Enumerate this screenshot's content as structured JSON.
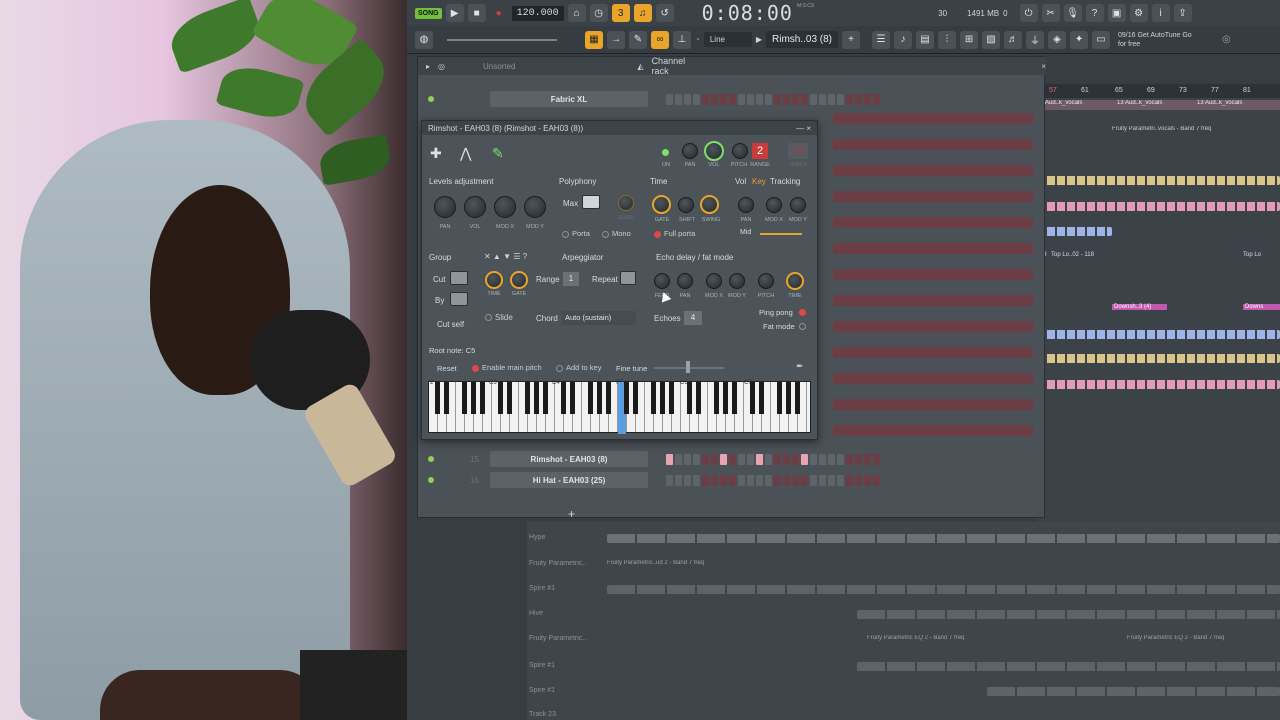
{
  "transport": {
    "song_label": "SONG",
    "tempo": "120.000",
    "time": "0:08:00",
    "time_unit": "M:S:CS",
    "cpu": "30",
    "memory": "1491 MB",
    "memory2": "0"
  },
  "toolbar": {
    "snap": "Line",
    "pattern": "Rimsh..03 (8)",
    "hint_line1": "09/16 Get AutoTune Go",
    "hint_line2": "for free"
  },
  "rack": {
    "filter": "Unsorted",
    "title": "Channel rack",
    "channels": [
      {
        "num": "",
        "name": "Fabric XL"
      },
      {
        "num": "15",
        "name": "Rimshot - EAH03 (8)"
      },
      {
        "num": "16",
        "name": "Hi Hat - EAH03 (25)"
      }
    ],
    "add": "+"
  },
  "plugin": {
    "title": "Rimshot - EAH03 (8) (Rimshot - EAH03 (8))",
    "num_red": "2",
    "num_dark": "15",
    "top_knob_labels": [
      "ON",
      "PAN",
      "VOL",
      "PITCH",
      "RANGE",
      "TRACK"
    ],
    "levels_title": "Levels adjustment",
    "levels_knobs": [
      "PAN",
      "VOL",
      "MOD X",
      "MOD Y"
    ],
    "poly_title": "Polyphony",
    "poly_max": "Max",
    "poly_slide": "SLIDE",
    "poly_porta": "Porta",
    "poly_mono": "Mono",
    "time_title": "Time",
    "time_knobs": [
      "GATE",
      "SHIFT",
      "SWING"
    ],
    "time_fullporta": "Full porta",
    "vol_label": "Vol",
    "key_label": "Key",
    "tracking_label": "Tracking",
    "tracking_knobs": [
      "PAN",
      "MOD X",
      "MOD Y"
    ],
    "tracking_mid": "Mid",
    "group_title": "Group",
    "cut_label": "Cut",
    "by_label": "By",
    "cutself_label": "Cut self",
    "arp_title": "Arpeggiator",
    "arp_range": "Range",
    "arp_range_val": "1",
    "arp_repeat": "Repeat",
    "arp_knobs": [
      "TIME",
      "GATE"
    ],
    "arp_slide": "Slide",
    "arp_chord": "Chord",
    "arp_chord_val": "Auto (sustain)",
    "echo_title": "Echo delay / fat mode",
    "echo_knobs": [
      "FEED",
      "PAN",
      "MOD X",
      "MOD Y",
      "PITCH",
      "TIME"
    ],
    "echoes_label": "Echoes",
    "echoes_val": "4",
    "pingpong": "Ping pong",
    "fatmode": "Fat mode",
    "root_note": "Root note: C5",
    "reset": "Reset",
    "enable_main_pitch": "Enable main pitch",
    "add_to_key": "Add to key",
    "fine_tune": "Fine tune",
    "octaves": [
      "2",
      "C3",
      "C4",
      "C5",
      "C6",
      "C7"
    ]
  },
  "playlist": {
    "bars": [
      "57",
      "61",
      "65",
      "69",
      "73",
      "77",
      "81"
    ],
    "clip_labels": [
      "13 Aud..k_vocals",
      "13 Aud..k_vocals",
      "13 Aud..k_vocals",
      "Fruity Parametri..vocals - Band 7 freq",
      "118",
      "Top Lo..02 - 118",
      "Top Lo",
      "Downsh..3 (4)",
      "Downs"
    ],
    "lower_tracks": [
      "Hype",
      "Fruity Parametric..",
      "Spire #1",
      "Hive",
      "Fruity Parametric..",
      "Spire #1",
      "Spire #1",
      "Track 23"
    ],
    "lower_clips": [
      "Fruity Parametric..ud 2 - Band 7 freq",
      "Fruity Parametric EQ 2 - Band 7 freq",
      "Fruity Parametric EQ 2 - Band 7 freq"
    ]
  },
  "colors": {
    "accent": "#e9a52a",
    "record": "#e03838",
    "song": "#6fc03a",
    "step_on": "#e7a4b3"
  }
}
